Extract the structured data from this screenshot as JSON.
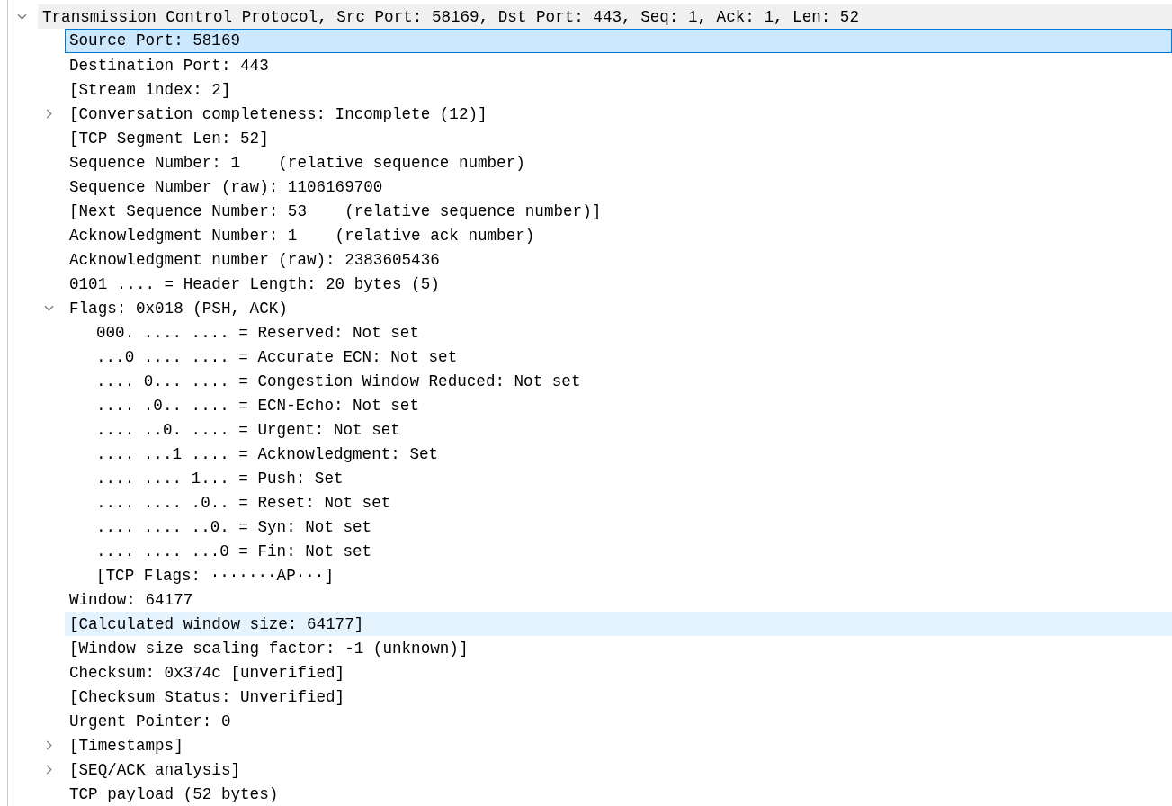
{
  "tree": [
    {
      "label": "Transmission Control Protocol, Src Port: 58169, Dst Port: 443, Seq: 1, Ack: 1, Len: 52",
      "selected": false,
      "hovered": false,
      "shaded": true,
      "expanded": true,
      "children": [
        {
          "label": "Source Port: 58169",
          "selected": true,
          "hovered": false,
          "shaded": false
        },
        {
          "label": "Destination Port: 443",
          "selected": false,
          "hovered": false,
          "shaded": false
        },
        {
          "label": "[Stream index: 2]",
          "selected": false,
          "hovered": false,
          "shaded": false
        },
        {
          "label": "[Conversation completeness: Incomplete (12)]",
          "selected": false,
          "hovered": false,
          "shaded": false,
          "expanded": false
        },
        {
          "label": "[TCP Segment Len: 52]",
          "selected": false,
          "hovered": false,
          "shaded": false
        },
        {
          "label": "Sequence Number: 1    (relative sequence number)",
          "selected": false,
          "hovered": false,
          "shaded": false
        },
        {
          "label": "Sequence Number (raw): 1106169700",
          "selected": false,
          "hovered": false,
          "shaded": false
        },
        {
          "label": "[Next Sequence Number: 53    (relative sequence number)]",
          "selected": false,
          "hovered": false,
          "shaded": false
        },
        {
          "label": "Acknowledgment Number: 1    (relative ack number)",
          "selected": false,
          "hovered": false,
          "shaded": false
        },
        {
          "label": "Acknowledgment number (raw): 2383605436",
          "selected": false,
          "hovered": false,
          "shaded": false
        },
        {
          "label": "0101 .... = Header Length: 20 bytes (5)",
          "selected": false,
          "hovered": false,
          "shaded": false
        },
        {
          "label": "Flags: 0x018 (PSH, ACK)",
          "selected": false,
          "hovered": false,
          "shaded": false,
          "expanded": true,
          "children": [
            {
              "label": "000. .... .... = Reserved: Not set",
              "selected": false,
              "hovered": false,
              "shaded": false
            },
            {
              "label": "...0 .... .... = Accurate ECN: Not set",
              "selected": false,
              "hovered": false,
              "shaded": false
            },
            {
              "label": ".... 0... .... = Congestion Window Reduced: Not set",
              "selected": false,
              "hovered": false,
              "shaded": false
            },
            {
              "label": ".... .0.. .... = ECN-Echo: Not set",
              "selected": false,
              "hovered": false,
              "shaded": false
            },
            {
              "label": ".... ..0. .... = Urgent: Not set",
              "selected": false,
              "hovered": false,
              "shaded": false
            },
            {
              "label": ".... ...1 .... = Acknowledgment: Set",
              "selected": false,
              "hovered": false,
              "shaded": false
            },
            {
              "label": ".... .... 1... = Push: Set",
              "selected": false,
              "hovered": false,
              "shaded": false
            },
            {
              "label": ".... .... .0.. = Reset: Not set",
              "selected": false,
              "hovered": false,
              "shaded": false
            },
            {
              "label": ".... .... ..0. = Syn: Not set",
              "selected": false,
              "hovered": false,
              "shaded": false
            },
            {
              "label": ".... .... ...0 = Fin: Not set",
              "selected": false,
              "hovered": false,
              "shaded": false
            },
            {
              "label": "[TCP Flags: ·······AP···]",
              "selected": false,
              "hovered": false,
              "shaded": false
            }
          ]
        },
        {
          "label": "Window: 64177",
          "selected": false,
          "hovered": false,
          "shaded": false
        },
        {
          "label": "[Calculated window size: 64177]",
          "selected": false,
          "hovered": true,
          "shaded": false
        },
        {
          "label": "[Window size scaling factor: -1 (unknown)]",
          "selected": false,
          "hovered": false,
          "shaded": false
        },
        {
          "label": "Checksum: 0x374c [unverified]",
          "selected": false,
          "hovered": false,
          "shaded": false
        },
        {
          "label": "[Checksum Status: Unverified]",
          "selected": false,
          "hovered": false,
          "shaded": false
        },
        {
          "label": "Urgent Pointer: 0",
          "selected": false,
          "hovered": false,
          "shaded": false
        },
        {
          "label": "[Timestamps]",
          "selected": false,
          "hovered": false,
          "shaded": false,
          "expanded": false
        },
        {
          "label": "[SEQ/ACK analysis]",
          "selected": false,
          "hovered": false,
          "shaded": false,
          "expanded": false
        },
        {
          "label": "TCP payload (52 bytes)",
          "selected": false,
          "hovered": false,
          "shaded": false
        }
      ]
    }
  ]
}
